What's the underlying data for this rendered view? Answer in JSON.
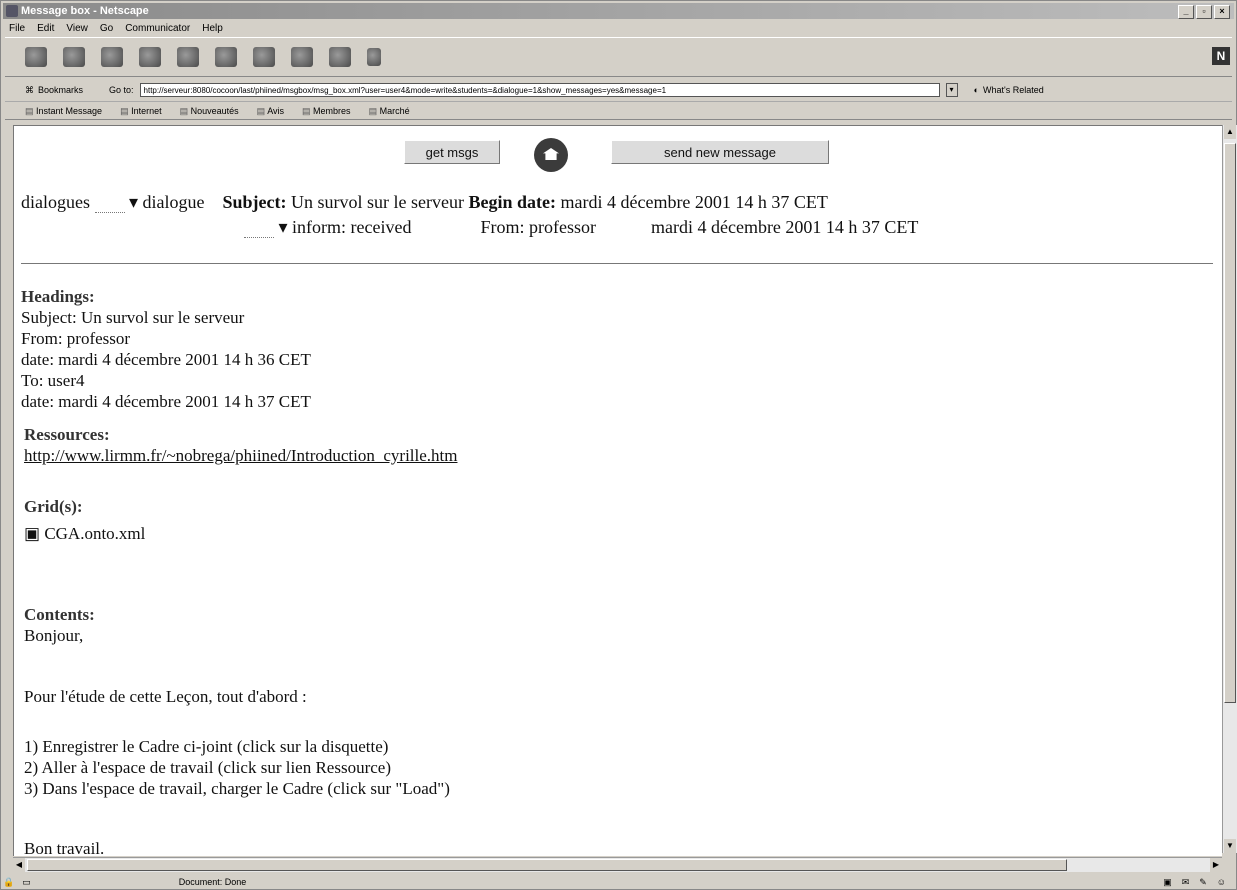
{
  "window": {
    "title": "Message box - Netscape",
    "buttons": [
      "_",
      "▫",
      "×"
    ]
  },
  "menu": [
    "File",
    "Edit",
    "View",
    "Go",
    "Communicator",
    "Help"
  ],
  "location": {
    "bookmarks": "Bookmarks",
    "goto_label": "Go to:",
    "url": "http://serveur:8080/cocoon/last/phiined/msgbox/msg_box.xml?user=user4&mode=write&students=&dialogue=1&show_messages=yes&message=1",
    "related": "What's Related"
  },
  "personal_toolbar": [
    "Instant Message",
    "Internet",
    "Nouveautés",
    "Avis",
    "Membres",
    "Marché"
  ],
  "page": {
    "get_msgs": "get msgs",
    "send_new": "send new message",
    "dialogues": "dialogues",
    "dialogue": "▾ dialogue",
    "subject_label": "Subject:",
    "subject_value": "Un survol sur le serveur",
    "begin_label": "Begin date:",
    "begin_value": "mardi 4 décembre 2001 14 h 37 CET",
    "inform": "▾ inform: received",
    "from_inline": "From: professor",
    "date_inline": "mardi 4 décembre 2001 14 h 37 CET",
    "headings_title": "Headings:",
    "headings": [
      "Subject: Un survol sur le serveur",
      "From: professor",
      "date: mardi 4 décembre 2001 14 h 36 CET",
      "To: user4",
      "date: mardi 4 décembre 2001 14 h 37 CET"
    ],
    "ressources_title": "Ressources:",
    "ressource_link": "http://www.lirmm.fr/~nobrega/phiined/Introduction_cyrille.htm",
    "grids_title": "Grid(s):",
    "grid_file": "CGA.onto.xml",
    "contents_title": "Contents:",
    "contents": {
      "greeting": "Bonjour,",
      "intro": "Pour l'étude de cette Leçon, tout d'abord :",
      "steps": [
        "1) Enregistrer le Cadre ci-joint (click sur la disquette)",
        "2) Aller à l'espace de travail (click sur lien Ressource)",
        "3) Dans l'espace de travail, charger le Cadre (click sur \"Load\")"
      ],
      "closing": "Bon travail."
    }
  },
  "status": {
    "text": "Document: Done"
  }
}
